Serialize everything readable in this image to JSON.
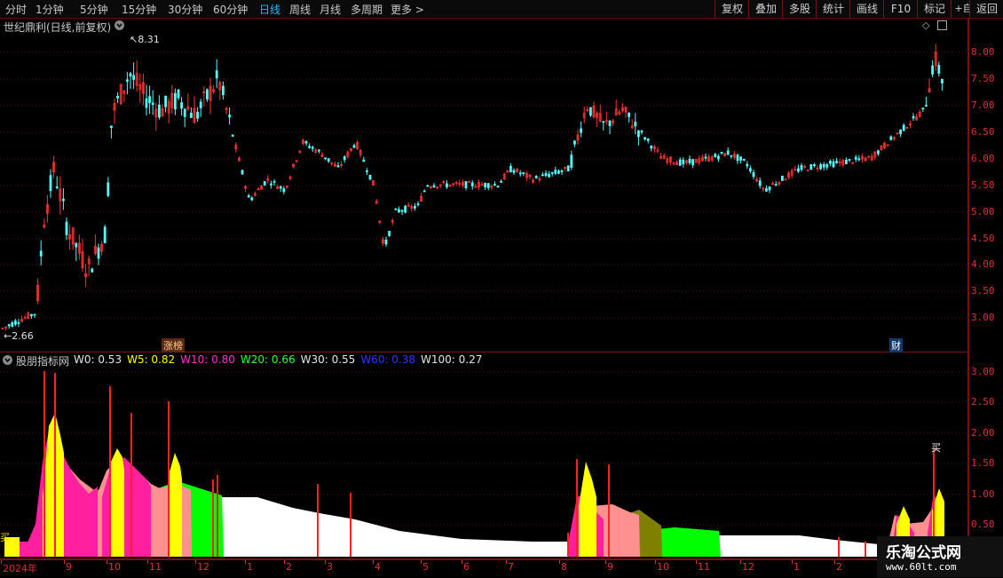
{
  "toolbar": {
    "periods": [
      "分时",
      "1分钟",
      "5分钟",
      "15分钟",
      "30分钟",
      "60分钟",
      "日线",
      "周线",
      "月线",
      "多周期",
      "更多 >"
    ],
    "active_period": "日线",
    "buttons": [
      "复权",
      "叠加",
      "多股",
      "统计",
      "画线",
      "F10",
      "标记",
      "+自选",
      "返回"
    ]
  },
  "main_chart": {
    "title": "世纪鼎利(日线,前复权)",
    "y_ticks": [
      "8.00",
      "7.50",
      "7.00",
      "6.50",
      "6.00",
      "5.50",
      "5.00",
      "4.50",
      "4.00",
      "3.50",
      "3.00"
    ],
    "high_label": "8.31",
    "low_label": "2.66",
    "tag_limit": "涨榜",
    "tag_finance": "财"
  },
  "indicator": {
    "name": "股朋指标网",
    "legend": [
      {
        "label": "W0: 0.53",
        "color": "#e6e6e6"
      },
      {
        "label": "W5: 0.82",
        "color": "#ffff00"
      },
      {
        "label": "W10: 0.80",
        "color": "#ff33cc"
      },
      {
        "label": "W20: 0.66",
        "color": "#33ff33"
      },
      {
        "label": "W30: 0.55",
        "color": "#e6e6e6"
      },
      {
        "label": "W60: 0.38",
        "color": "#3333ff"
      },
      {
        "label": "W100: 0.27",
        "color": "#e6e6e6"
      }
    ],
    "y_ticks": [
      "3.00",
      "2.50",
      "2.00",
      "1.50",
      "1.00",
      "0.50"
    ],
    "buy_label": "买"
  },
  "x_axis": {
    "labels": [
      "2024年",
      "9",
      "10",
      "11",
      "12",
      "1",
      "2",
      "3",
      "4",
      "5",
      "6",
      "7",
      "8",
      "9",
      "10",
      "11",
      "12",
      "1",
      "2"
    ]
  },
  "watermark": {
    "title": "乐淘公式网",
    "url": "www.60lt.com"
  },
  "colors": {
    "up": "#ff3232",
    "down": "#54ffff",
    "grid": "#7a1010",
    "active": "#33b5ff"
  }
}
